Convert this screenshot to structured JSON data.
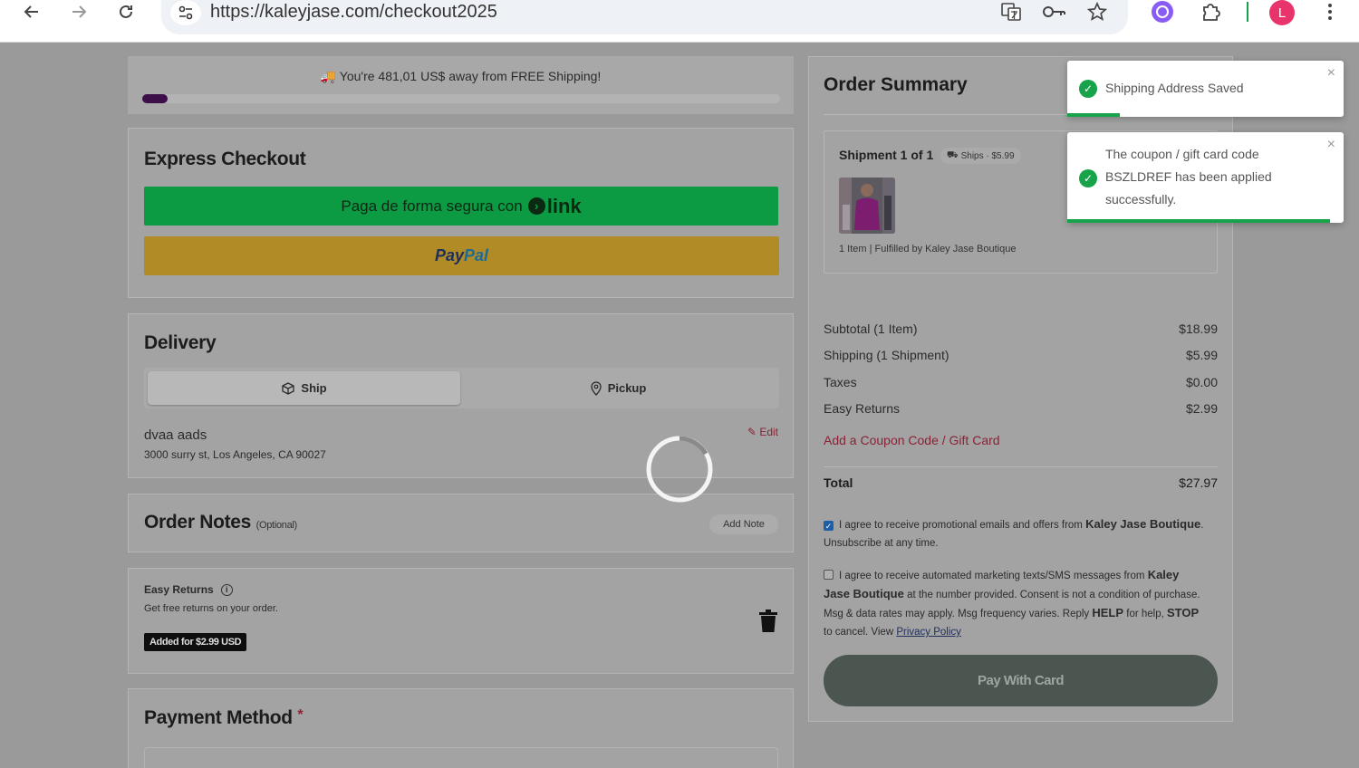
{
  "browser": {
    "url": "https://kaleyjase.com/checkout2025",
    "avatar_letter": "L"
  },
  "shipping_banner": {
    "text": "You're 481,01 US$ away from FREE Shipping!",
    "progress_fraction": 0.04
  },
  "express": {
    "title": "Express Checkout",
    "link_label": "Paga de forma segura con",
    "link_brand": "link",
    "paypal_a": "Pay",
    "paypal_b": "Pal"
  },
  "delivery": {
    "title": "Delivery",
    "tab_ship": "Ship",
    "tab_pickup": "Pickup",
    "name": "dvaa aads",
    "address": "3000 surry st, Los Angeles, CA 90027",
    "edit_label": "Edit"
  },
  "notes": {
    "title": "Order Notes",
    "optional": "(Optional)",
    "add_label": "Add Note"
  },
  "easy_returns": {
    "title": "Easy Returns",
    "subtitle": "Get free returns on your order.",
    "badge": "Added for $2.99 USD"
  },
  "payment": {
    "title": "Payment Method",
    "required": "*"
  },
  "summary": {
    "title": "Order Summary",
    "shipment_title": "Shipment 1 of 1",
    "shipment_badge": "Ships · $5.99",
    "shipment_meta": "1 Item | Fulfilled by Kaley Jase Boutique",
    "rows": [
      {
        "label": "Subtotal (1 Item)",
        "value": "$18.99"
      },
      {
        "label": "Shipping (1 Shipment)",
        "value": "$5.99"
      },
      {
        "label": "Taxes",
        "value": "$0.00"
      },
      {
        "label": "Easy Returns",
        "value": "$2.99"
      }
    ],
    "coupon_link": "Add a Coupon Code / Gift Card",
    "total_label": "Total",
    "total_value": "$27.97",
    "consent_email_a": "I agree to receive promotional emails and offers from",
    "consent_email_brand": "Kaley Jase Boutique",
    "consent_email_b": ". Unsubscribe at any time.",
    "consent_email_checked": true,
    "consent_sms_a": "I agree to receive automated marketing texts/SMS messages from",
    "consent_sms_brand": "Kaley Jase Boutique",
    "consent_sms_b": "at the number provided. Consent is not a condition of purchase. Msg & data rates may apply. Msg frequency varies. Reply",
    "consent_sms_help": "HELP",
    "consent_sms_c": "for help,",
    "consent_sms_stop": "STOP",
    "consent_sms_d": "to cancel. View",
    "consent_sms_privacy": "Privacy Policy",
    "consent_sms_checked": false,
    "pay_button": "Pay With Card"
  },
  "toasts": [
    {
      "text": "Shipping Address Saved",
      "progress_fraction": 0.19
    },
    {
      "text": "The coupon / gift card code BSZLDREF has been applied successfully.",
      "progress_fraction": 0.95
    }
  ],
  "icons": {
    "back": "arrow-left-icon",
    "forward": "arrow-right-icon",
    "reload": "reload-icon",
    "site_settings": "tune-icon",
    "translate": "translate-icon",
    "password": "key-icon",
    "bookmark": "star-icon",
    "extension_ai": "ai-extension-icon",
    "extensions": "puzzle-icon",
    "menu": "kebab-menu-icon",
    "check": "check-circle-icon"
  },
  "colors": {
    "link_green": "#0c9a43",
    "paypal_gold": "#b18c26",
    "progress_purple": "#3c0f4a",
    "accent_red": "#8b2236",
    "pay_button": "#4b5650",
    "toast_green": "#16a34a"
  }
}
